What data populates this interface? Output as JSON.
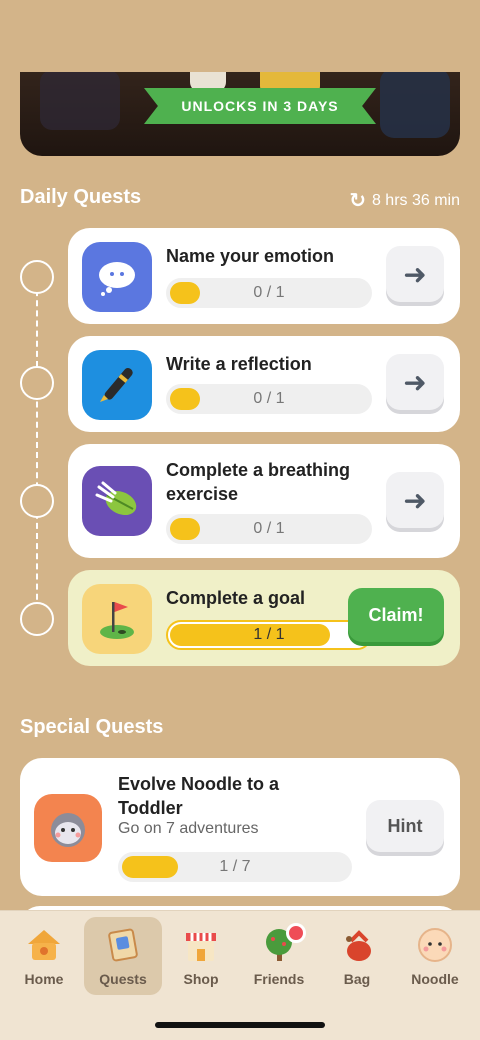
{
  "banner": {
    "ribbon_text": "UNLOCKS IN 3 DAYS"
  },
  "daily": {
    "title": "Daily Quests",
    "timer": "8 hrs 36 min",
    "timer_icon": "refresh-icon",
    "quests": [
      {
        "title": "Name your emotion",
        "progress": "0 / 1",
        "fraction": 0,
        "icon": "thought-cloud-icon",
        "icon_color": "#5b77e0"
      },
      {
        "title": "Write a reflection",
        "progress": "0 / 1",
        "fraction": 0,
        "icon": "pen-icon",
        "icon_color": "#1e8fe0"
      },
      {
        "title": "Complete a breathing exercise",
        "progress": "0 / 1",
        "fraction": 0,
        "icon": "leaf-icon",
        "icon_color": "#6a4fb4"
      },
      {
        "title": "Complete a goal",
        "progress": "1 / 1",
        "fraction": 1,
        "icon": "golf-flag-icon",
        "icon_color": "#f7d57a",
        "action": "Claim!"
      }
    ]
  },
  "special": {
    "title": "Special Quests",
    "quest": {
      "title": "Evolve Noodle to a Toddler",
      "subtitle": "Go on 7 adventures",
      "progress": "1 / 7",
      "fraction": 0.142857,
      "action": "Hint",
      "icon": "noodle-face-icon"
    }
  },
  "tabs": [
    {
      "label": "Home",
      "icon": "home-icon",
      "active": false
    },
    {
      "label": "Quests",
      "icon": "quests-book-icon",
      "active": true
    },
    {
      "label": "Shop",
      "icon": "shop-icon",
      "active": false
    },
    {
      "label": "Friends",
      "icon": "tree-icon",
      "active": false,
      "badge": true
    },
    {
      "label": "Bag",
      "icon": "bag-icon",
      "active": false
    },
    {
      "label": "Noodle",
      "icon": "noodle-icon",
      "active": false
    }
  ],
  "colors": {
    "background": "#d3b489",
    "accent_green": "#4fb14f",
    "progress_yellow": "#f5c21b"
  }
}
